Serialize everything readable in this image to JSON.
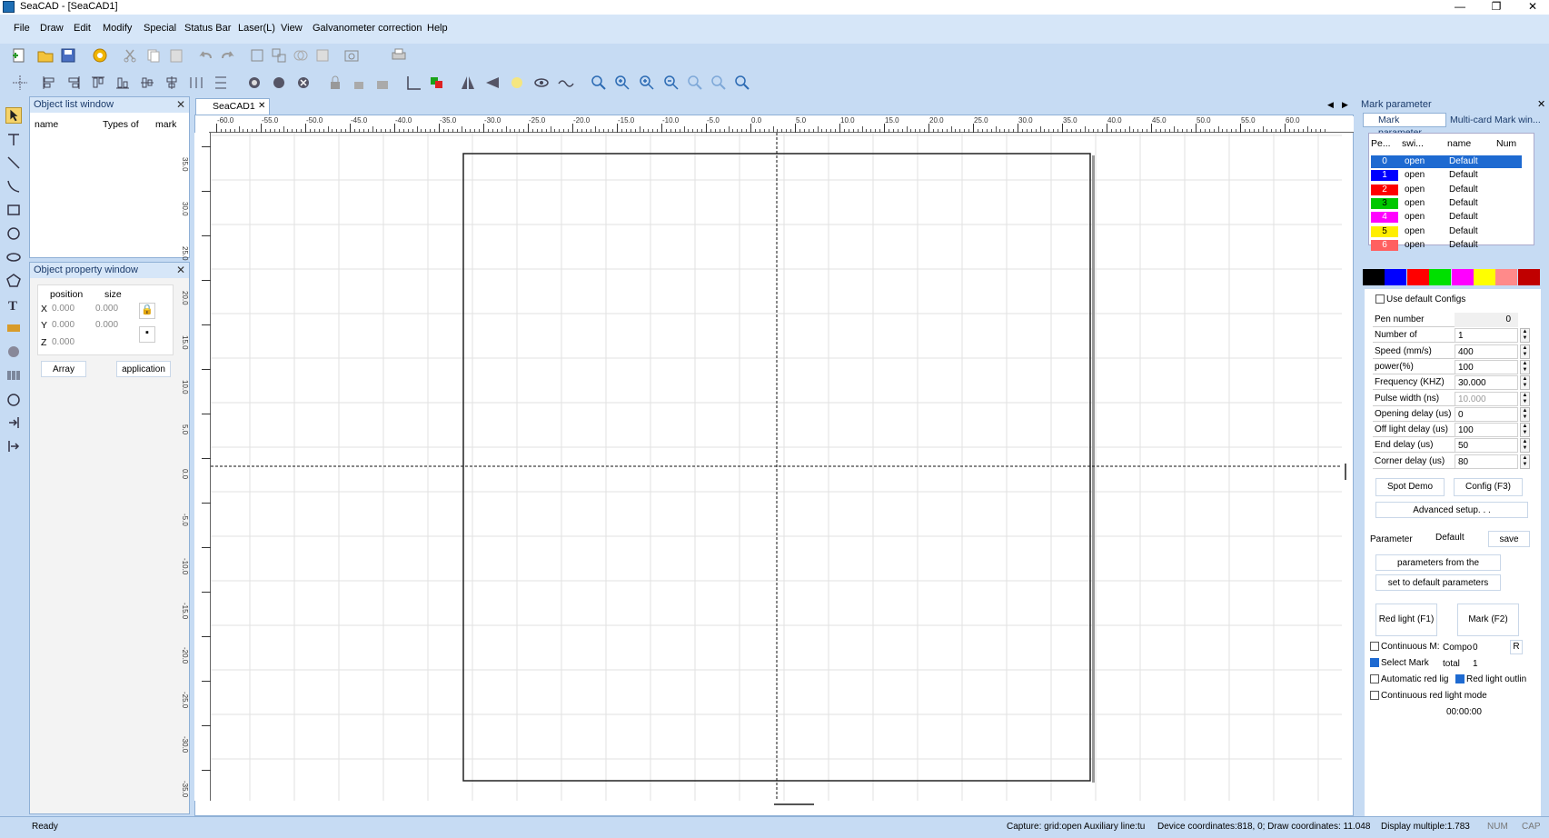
{
  "window": {
    "title": "SeaCAD - [SeaCAD1]",
    "min": "—",
    "max": "❐",
    "close": "✕"
  },
  "menu": [
    "File",
    "Draw",
    "Edit",
    "Modify",
    "Special",
    "Status Bar",
    "Laser(L)",
    "View",
    "Galvanometer correction",
    "Help"
  ],
  "object_list": {
    "title": "Object list window",
    "cols": [
      "name",
      "Types of",
      "mark"
    ]
  },
  "object_property": {
    "title": "Object property window",
    "position": "position",
    "size": "size",
    "x_label": "X",
    "y_label": "Y",
    "z_label": "Z",
    "x_pos": "0.000",
    "x_size": "0.000",
    "y_pos": "0.000",
    "y_size": "0.000",
    "z_pos": "0.000",
    "array": "Array",
    "application": "application"
  },
  "tab": {
    "label": "SeaCAD1",
    "close": "✕"
  },
  "ruler_h": [
    "-60.0",
    "-55.0",
    "-50.0",
    "-45.0",
    "-40.0",
    "-35.0",
    "-30.0",
    "-25.0",
    "-20.0",
    "-15.0",
    "-10.0",
    "-5.0",
    "0.0",
    "5.0",
    "10.0",
    "15.0",
    "20.0",
    "25.0",
    "30.0",
    "35.0",
    "40.0",
    "45.0",
    "50.0",
    "55.0",
    "60.0"
  ],
  "ruler_v": [
    "35.0",
    "30.0",
    "25.0",
    "20.0",
    "15.0",
    "10.0",
    "5.0",
    "0.0",
    "-5.0",
    "-10.0",
    "-15.0",
    "-20.0",
    "-25.0",
    "-30.0",
    "-35.0"
  ],
  "mark_param": {
    "title": "Mark parameter",
    "tab1": "Mark parameter",
    "tab2": "Multi-card Mark win...",
    "cols": [
      "Pe...",
      "swi...",
      "name",
      "Num"
    ],
    "pens": [
      {
        "num": "0",
        "sw": "open",
        "name": "Default",
        "color": "#1e6ad1"
      },
      {
        "num": "1",
        "sw": "open",
        "name": "Default",
        "color": "#0000ff"
      },
      {
        "num": "2",
        "sw": "open",
        "name": "Default",
        "color": "#ff0000"
      },
      {
        "num": "3",
        "sw": "open",
        "name": "Default",
        "color": "#00c800"
      },
      {
        "num": "4",
        "sw": "open",
        "name": "Default",
        "color": "#ff00ff"
      },
      {
        "num": "5",
        "sw": "open",
        "name": "Default",
        "color": "#ffee00"
      },
      {
        "num": "6",
        "sw": "open",
        "name": "Default",
        "color": "#ff6060"
      }
    ],
    "palette": [
      "#000000",
      "#0000ff",
      "#ff0000",
      "#00e000",
      "#ff00ff",
      "#ffff00",
      "#ff8a8a",
      "#c00000"
    ],
    "use_default": "Use default Configs",
    "params": [
      {
        "label": "Pen number",
        "value": "0",
        "spin": false
      },
      {
        "label": "Number of processir",
        "value": "1",
        "spin": true
      },
      {
        "label": "Speed (mm/s)",
        "value": "400",
        "spin": true
      },
      {
        "label": "power(%)",
        "value": "100",
        "spin": true
      },
      {
        "label": "Frequency (KHZ)",
        "value": "30.000",
        "spin": true
      },
      {
        "label": "Pulse width (ns)",
        "value": "10.000",
        "spin": true
      },
      {
        "label": "Opening delay (us)",
        "value": "0",
        "spin": true
      },
      {
        "label": "Off light delay (us)",
        "value": "100",
        "spin": true
      },
      {
        "label": "End delay (us)",
        "value": "50",
        "spin": true
      },
      {
        "label": "Corner delay (us)",
        "value": "80",
        "spin": true
      }
    ],
    "spot_demo": "Spot Demo",
    "config": "Config (F3)",
    "advanced": "Advanced setup. . .",
    "parameter_label": "Parameter",
    "parameter_value": "Default",
    "save": "save",
    "from_param": "parameters from the parameter",
    "set_default": "set to default parameters",
    "red_light": "Red light (F1)",
    "mark": "Mark (F2)",
    "continuous_mark": "Continuous M:",
    "compo": "Compo",
    "compo_val": "0",
    "r": "R",
    "select_mark": "Select Mark",
    "total": "total",
    "total_val": "1",
    "auto_red": "Automatic red lig",
    "red_outline": "Red light outlin",
    "cont_red": "Continuous red light mode",
    "time": "00:00:00"
  },
  "status": {
    "ready": "Ready",
    "capture": "Capture: grid:open Auxiliary line:tu",
    "device": "Device coordinates:818,  0; Draw coordinates: 11.048",
    "display": "Display multiple:1.783",
    "num": "NUM",
    "cap": "CAP"
  }
}
